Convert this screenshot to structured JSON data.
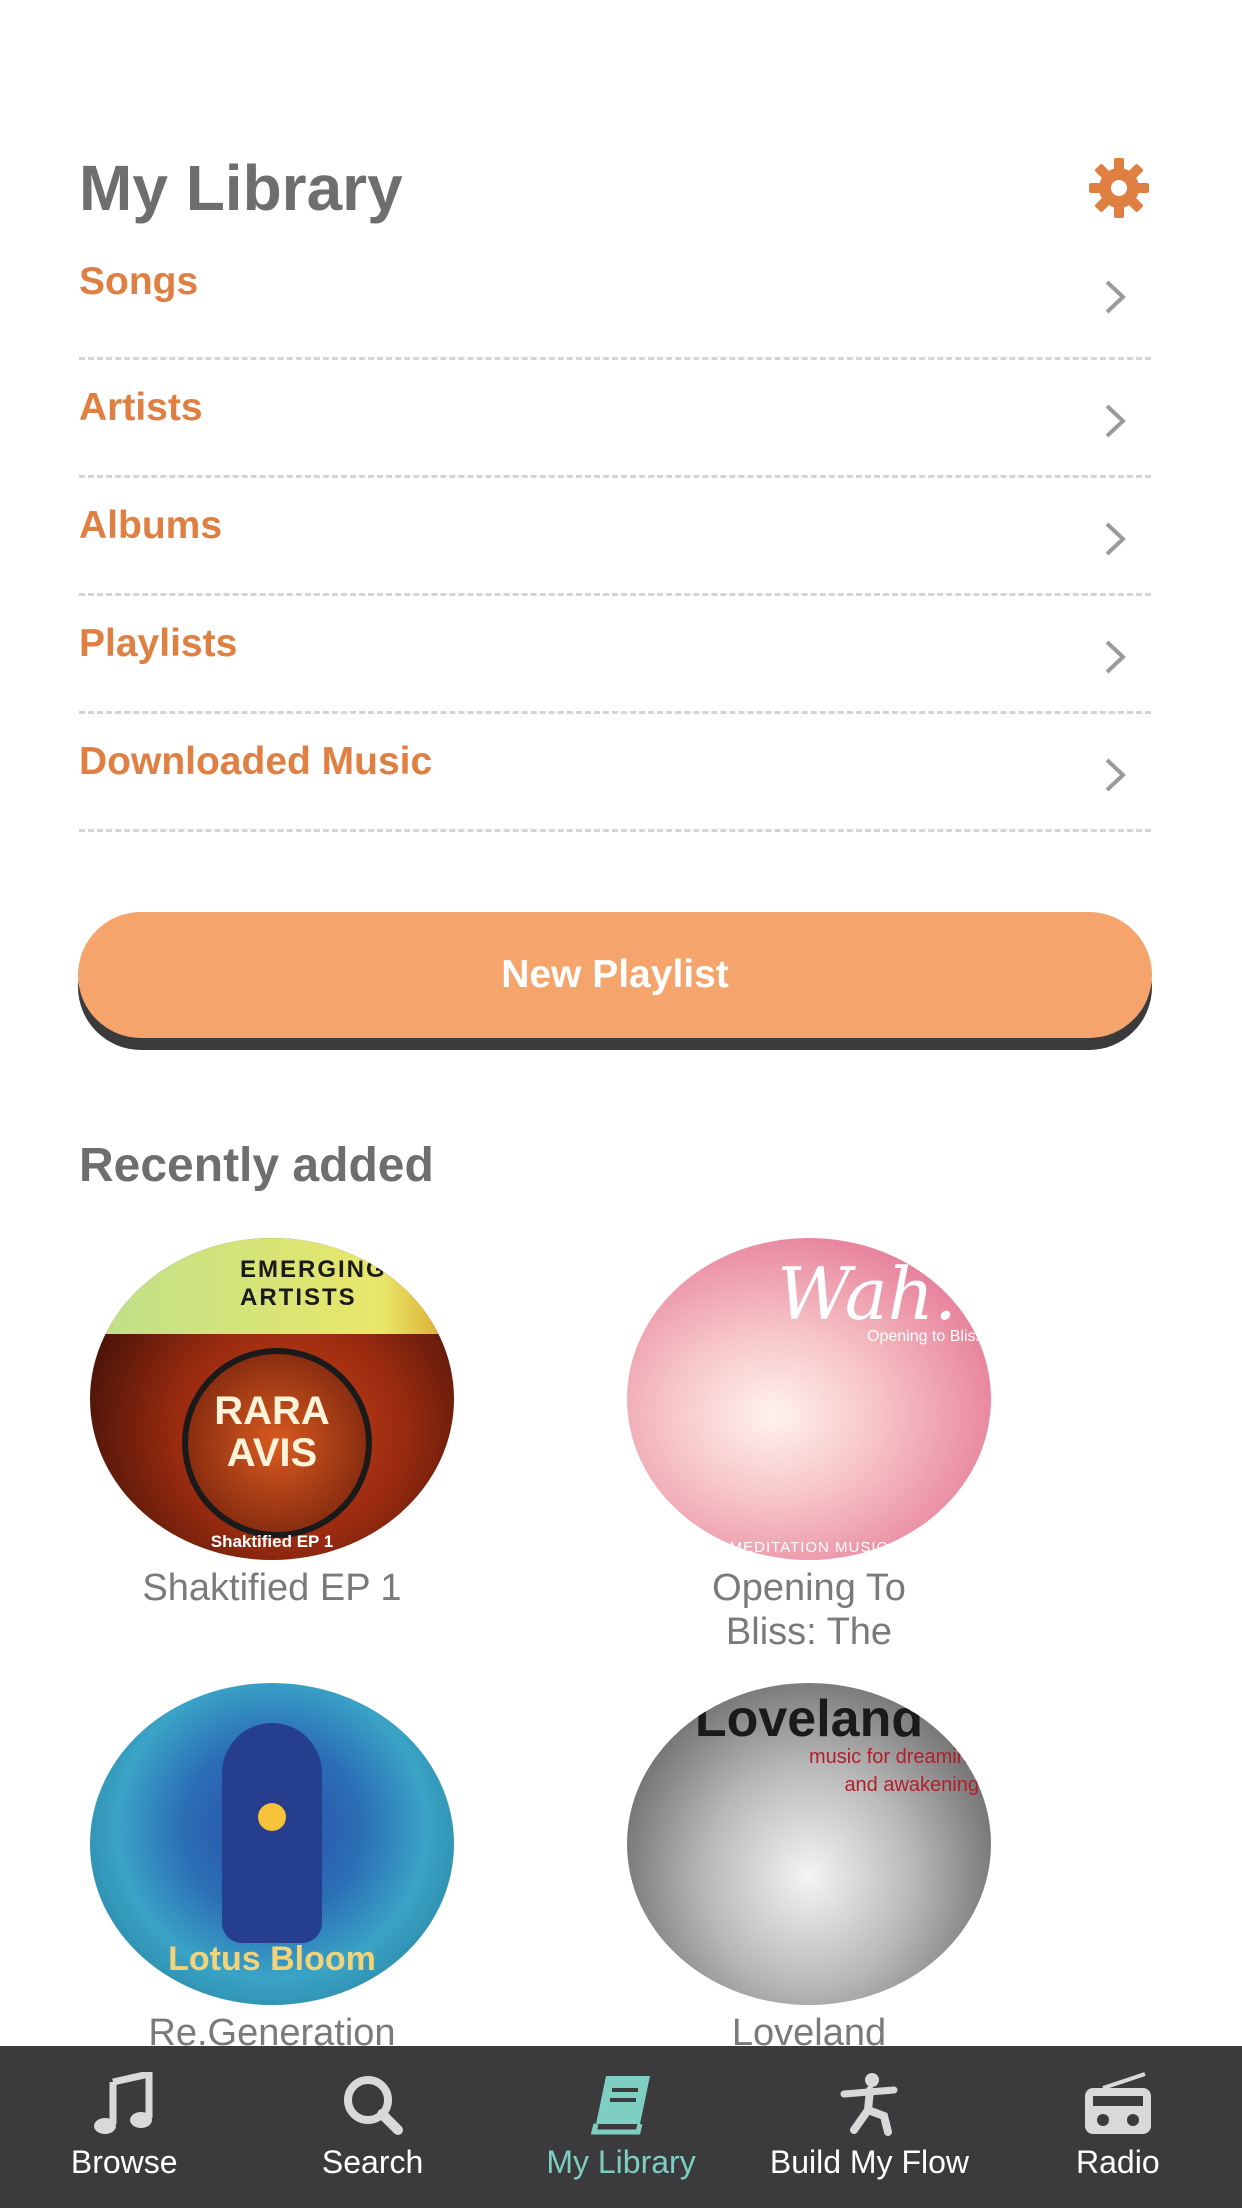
{
  "header": {
    "title": "My Library",
    "settings_icon": "gear-icon"
  },
  "colors": {
    "accent": "#e07f42",
    "button": "#f5a56b",
    "tabbar": "#3b3b3d",
    "active_tab": "#7ecfc2",
    "title": "#6e6e6e"
  },
  "menu": [
    {
      "label": "Songs"
    },
    {
      "label": "Artists"
    },
    {
      "label": "Albums"
    },
    {
      "label": "Playlists"
    },
    {
      "label": "Downloaded Music"
    }
  ],
  "new_playlist_label": "New Playlist",
  "recent": {
    "title": "Recently added",
    "albums": [
      {
        "name": "Shaktified EP 1",
        "art_lines": [
          "EMERGING",
          "ARTISTS"
        ],
        "art_title": [
          "RARA",
          "AVIS"
        ],
        "art_footer": "Shaktified EP 1"
      },
      {
        "name_lines": [
          "Opening To",
          "Bliss: The"
        ],
        "art_title": "Wah.",
        "art_subtitle": "Opening to Bliss",
        "art_footer": "MEDITATION MUSIC"
      },
      {
        "name": "Re.Generation",
        "art_title": "Lotus Bloom"
      },
      {
        "name": "Loveland",
        "art_title": "Loveland",
        "art_subtitle": [
          "music for dreaming",
          "and awakening"
        ]
      }
    ]
  },
  "tabs": [
    {
      "label": "Browse",
      "icon": "music-note-icon"
    },
    {
      "label": "Search",
      "icon": "search-icon"
    },
    {
      "label": "My Library",
      "icon": "book-icon",
      "active": true
    },
    {
      "label": "Build My Flow",
      "icon": "yoga-figure-icon"
    },
    {
      "label": "Radio",
      "icon": "radio-icon"
    }
  ]
}
